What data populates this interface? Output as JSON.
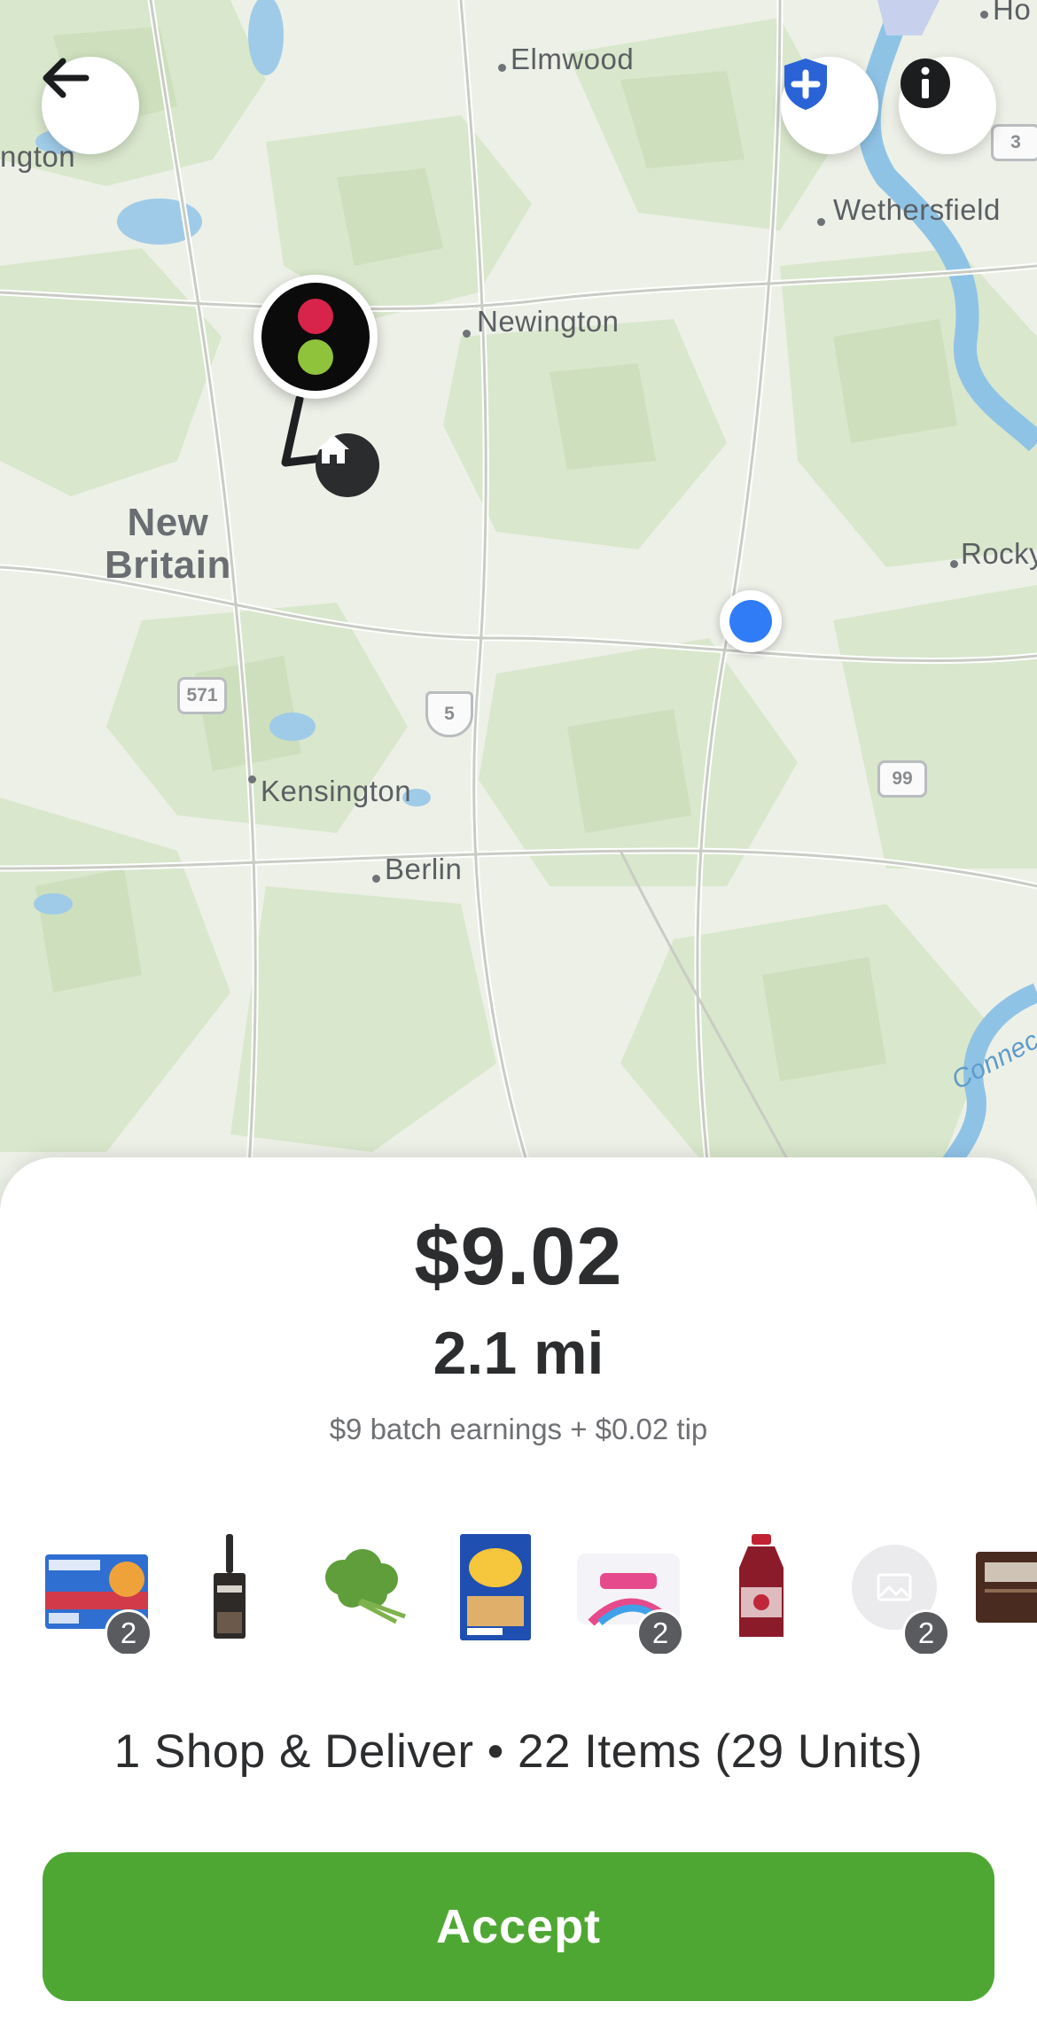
{
  "map": {
    "towns": {
      "elmwood": "Elmwood",
      "newington": "Newington",
      "wethersfield": "Wethersfield",
      "new_britain_line1": "New",
      "new_britain_line2": "Britain",
      "kensington": "Kensington",
      "berlin": "Berlin",
      "rocky": "Rocky",
      "hartford_edge": "ngton",
      "top_right_edge": "Ho",
      "river": "Connec"
    },
    "route_shields": {
      "r571": "571",
      "r5": "5",
      "r99": "99",
      "r3": "3"
    },
    "icons": {
      "back": "back-arrow-icon",
      "safety": "shield-plus-icon",
      "info": "info-icon",
      "store": "store-logo-icon",
      "home": "home-icon",
      "location": "current-location-icon"
    }
  },
  "offer": {
    "price": "$9.02",
    "distance": "2.1 mi",
    "breakdown": "$9 batch earnings + $0.02 tip",
    "summary": "1 Shop & Deliver • 22 Items (29 Units)",
    "accept_label": "Accept"
  },
  "items": [
    {
      "name": "capri-sun-fruit-punch",
      "qty": "2"
    },
    {
      "name": "kitchen-tool",
      "qty": ""
    },
    {
      "name": "cilantro",
      "qty": ""
    },
    {
      "name": "honey-maid-grahams",
      "qty": ""
    },
    {
      "name": "jet-puffed-marshmallows",
      "qty": "2"
    },
    {
      "name": "cranberry-juice",
      "qty": ""
    },
    {
      "name": "image-placeholder",
      "qty": "2"
    },
    {
      "name": "hershey-bar",
      "qty": ""
    }
  ],
  "colors": {
    "accept_green": "#4fa733",
    "safety_blue": "#2a63d6",
    "location_blue": "#2f7cf6",
    "text_dark": "#2c2d2f"
  }
}
